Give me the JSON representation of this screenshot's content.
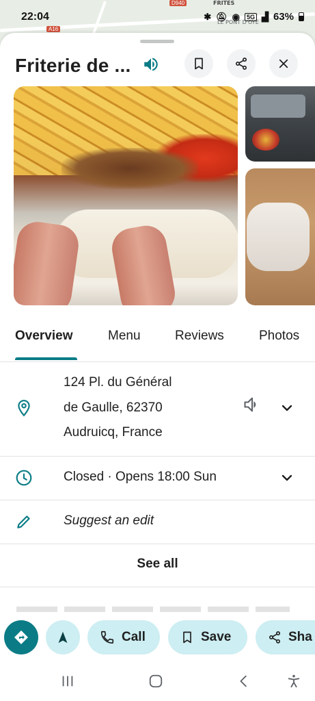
{
  "map": {
    "labels": [
      "FRITES",
      "LE PONT D'OYE",
      "D940",
      "A16"
    ]
  },
  "status_bar": {
    "time": "22:04",
    "battery": "63%",
    "network": "5G"
  },
  "header": {
    "title": "Friterie de ..."
  },
  "tabs": [
    {
      "label": "Overview",
      "active": true
    },
    {
      "label": "Menu",
      "active": false
    },
    {
      "label": "Reviews",
      "active": false
    },
    {
      "label": "Photos",
      "active": false
    }
  ],
  "address": {
    "line1": "124 Pl. du Général",
    "line2": "de Gaulle, 62370",
    "line3": "Audruicq, France"
  },
  "hours": {
    "text": "Closed · Opens 18:00 Sun"
  },
  "suggest_edit": {
    "label": "Suggest an edit"
  },
  "see_all": {
    "label": "See all"
  },
  "actions": {
    "call_label": "Call",
    "save_label": "Save",
    "share_label": "Sha"
  },
  "colors": {
    "accent": "#0b7c86",
    "chip": "#cdeef2"
  }
}
